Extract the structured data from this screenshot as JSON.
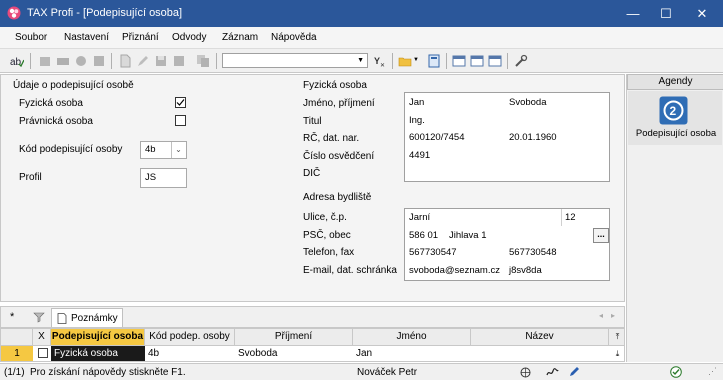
{
  "window": {
    "title": "TAX Profi - [Podepisující osoba]",
    "minimize": "—",
    "maximize": "☐",
    "close": "✕"
  },
  "menu": [
    {
      "label": "Soubor"
    },
    {
      "label": "Nastavení"
    },
    {
      "label": "Přiznání"
    },
    {
      "label": "Odvody"
    },
    {
      "label": "Záznam"
    },
    {
      "label": "Nápověda"
    }
  ],
  "left": {
    "section_title": "Údaje o podepisující osobě",
    "fyzicka_label": "Fyzická osoba",
    "fyzicka_checked": true,
    "pravnicka_label": "Právnická osoba",
    "pravnicka_checked": false,
    "kod_label": "Kód podepisující osoby",
    "kod_value": "4b",
    "profil_label": "Profil",
    "profil_value": "JS"
  },
  "person": {
    "section_title": "Fyzická osoba",
    "jmeno_label": "Jméno, příjmení",
    "titul_label": "Titul",
    "rc_label": "RČ, dat. nar.",
    "cislo_label": "Číslo osvědčení",
    "dic_label": "DIČ",
    "jmeno": "Jan",
    "prijmeni": "Svoboda",
    "titul": "Ing.",
    "rc": "600120/7454",
    "dat_nar": "20.01.1960",
    "cislo": "4491",
    "dic": ""
  },
  "address": {
    "section_title": "Adresa bydliště",
    "ulice_label": "Ulice, č.p.",
    "psc_label": "PSČ, obec",
    "telefon_label": "Telefon, fax",
    "email_label": "E-mail, dat. schránka",
    "ulice": "Jarní",
    "cp": "12",
    "psc": "586 01",
    "obec": "Jihlava 1",
    "telefon": "567730547",
    "fax": "567730548",
    "email": "svoboda@seznam.cz",
    "schranka": "j8sv8da",
    "browse_label": "..."
  },
  "agenda": {
    "header": "Agendy",
    "item_label": "Podepisující osoba"
  },
  "tabs": {
    "star": "*",
    "notes_label": "Poznámky"
  },
  "grid": {
    "columns": [
      "X",
      "Podepisující osoba",
      "Kód podep. osoby",
      "Příjmení",
      "Jméno",
      "Název"
    ],
    "rows": [
      {
        "num": "1",
        "x": "",
        "osoba": "Fyzická osoba",
        "kod": "4b",
        "prijmeni": "Svoboda",
        "jmeno": "Jan",
        "nazev": ""
      }
    ]
  },
  "status": {
    "records": "(1/1)",
    "hint": "Pro získání nápovědy stiskněte F1.",
    "user": "Nováček Petr"
  },
  "colors": {
    "titlebar": "#2b579a",
    "highlight": "#f5c842",
    "rowselect": "#1a1a1a",
    "agenda_icon": "#2f6db5"
  }
}
